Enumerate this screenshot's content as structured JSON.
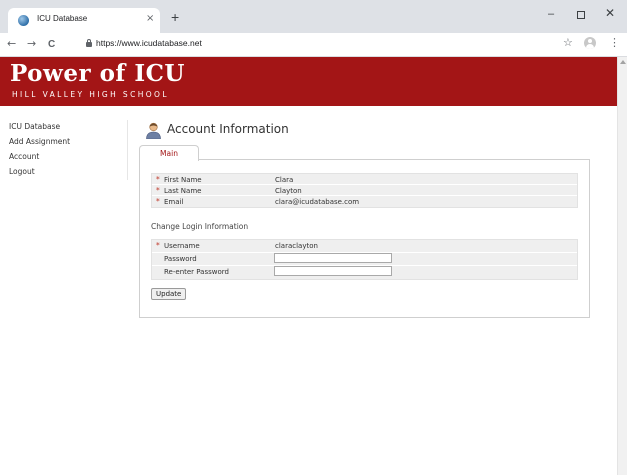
{
  "browser": {
    "tab_title": "ICU Database",
    "tab_close": "×",
    "new_tab": "+",
    "url": "https://www.icudatabase.net",
    "controls": {
      "minimize": "–",
      "close": "✕"
    },
    "nav": {
      "back": "←",
      "forward": "→",
      "reload": "C"
    },
    "icons": {
      "star": "☆",
      "menu": "⋮"
    }
  },
  "header": {
    "title": "Power of ICU",
    "subtitle": "HILL VALLEY HIGH SCHOOL",
    "background_color": "#a31516"
  },
  "sidebar": {
    "items": [
      {
        "label": "ICU Database"
      },
      {
        "label": "Add Assignment"
      },
      {
        "label": "Account"
      },
      {
        "label": "Logout"
      }
    ]
  },
  "main": {
    "title": "Account Information",
    "tabs": [
      {
        "label": "Main"
      }
    ],
    "required_marker": "*",
    "personal": [
      {
        "label": "First Name",
        "value": "Clara",
        "required": true
      },
      {
        "label": "Last Name",
        "value": "Clayton",
        "required": true
      },
      {
        "label": "Email",
        "value": "clara@icudatabase.com",
        "required": true
      }
    ],
    "login_section_title": "Change Login Information",
    "login": {
      "username_label": "Username",
      "username_value": "claraclayton",
      "password_label": "Password",
      "password_value": "",
      "reenter_label": "Re-enter Password",
      "reenter_value": ""
    },
    "update_label": "Update"
  }
}
